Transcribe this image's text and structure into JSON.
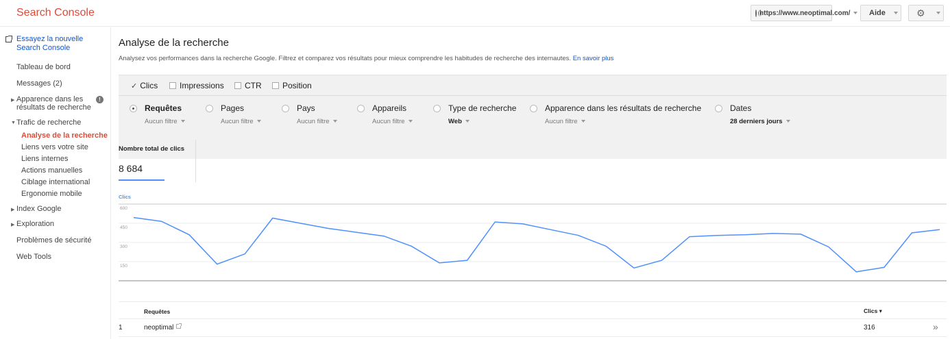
{
  "header": {
    "logo": "Search Console",
    "site": "https://www.neoptimal.com/",
    "help": "Aide",
    "settings_icon": "gear-icon"
  },
  "sidebar": {
    "new_console": "Essayez la nouvelle Search Console",
    "items": [
      {
        "label": "Tableau de bord"
      },
      {
        "label": "Messages (2)"
      },
      {
        "label": "Apparence dans les résultats de recherche"
      },
      {
        "label": "Trafic de recherche"
      },
      {
        "label": "Index Google"
      },
      {
        "label": "Exploration"
      },
      {
        "label": "Problèmes de sécurité"
      },
      {
        "label": "Web Tools"
      }
    ],
    "traffic_sub": [
      {
        "label": "Analyse de la recherche",
        "active": true
      },
      {
        "label": "Liens vers votre site"
      },
      {
        "label": "Liens internes"
      },
      {
        "label": "Actions manuelles"
      },
      {
        "label": "Ciblage international"
      },
      {
        "label": "Ergonomie mobile"
      }
    ]
  },
  "main": {
    "title": "Analyse de la recherche",
    "description": "Analysez vos performances dans la recherche Google. Filtrez et comparez vos résultats pour mieux comprendre les habitudes de recherche des internautes.",
    "learn_more": "En savoir plus",
    "metrics": [
      {
        "label": "Clics",
        "checked": true
      },
      {
        "label": "Impressions",
        "checked": false
      },
      {
        "label": "CTR",
        "checked": false
      },
      {
        "label": "Position",
        "checked": false
      }
    ],
    "dimensions": [
      {
        "label": "Requêtes",
        "sub": "Aucun filtre",
        "selected": true
      },
      {
        "label": "Pages",
        "sub": "Aucun filtre"
      },
      {
        "label": "Pays",
        "sub": "Aucun filtre"
      },
      {
        "label": "Appareils",
        "sub": "Aucun filtre"
      },
      {
        "label": "Type de recherche",
        "sub": "Web"
      },
      {
        "label": "Apparence dans les résultats de recherche",
        "sub": "Aucun filtre"
      },
      {
        "label": "Dates",
        "sub": "28 derniers jours"
      }
    ],
    "total_label": "Nombre total de clics",
    "total_value": "8 684",
    "table": {
      "col_query": "Requêtes",
      "col_clicks": "Clics ▾",
      "rows": [
        {
          "num": "1",
          "query": "neoptimal",
          "clicks": "316"
        }
      ]
    }
  },
  "chart_data": {
    "type": "line",
    "series_label": "Clics",
    "color": "#4d90fe",
    "ylim": [
      0,
      600
    ],
    "yticks": [
      "600",
      "450",
      "300",
      "150"
    ],
    "grid": true,
    "values": [
      495,
      465,
      360,
      130,
      210,
      490,
      450,
      410,
      380,
      350,
      270,
      140,
      160,
      460,
      445,
      400,
      355,
      270,
      100,
      160,
      345,
      355,
      360,
      370,
      365,
      265,
      70,
      105,
      375,
      400
    ]
  }
}
